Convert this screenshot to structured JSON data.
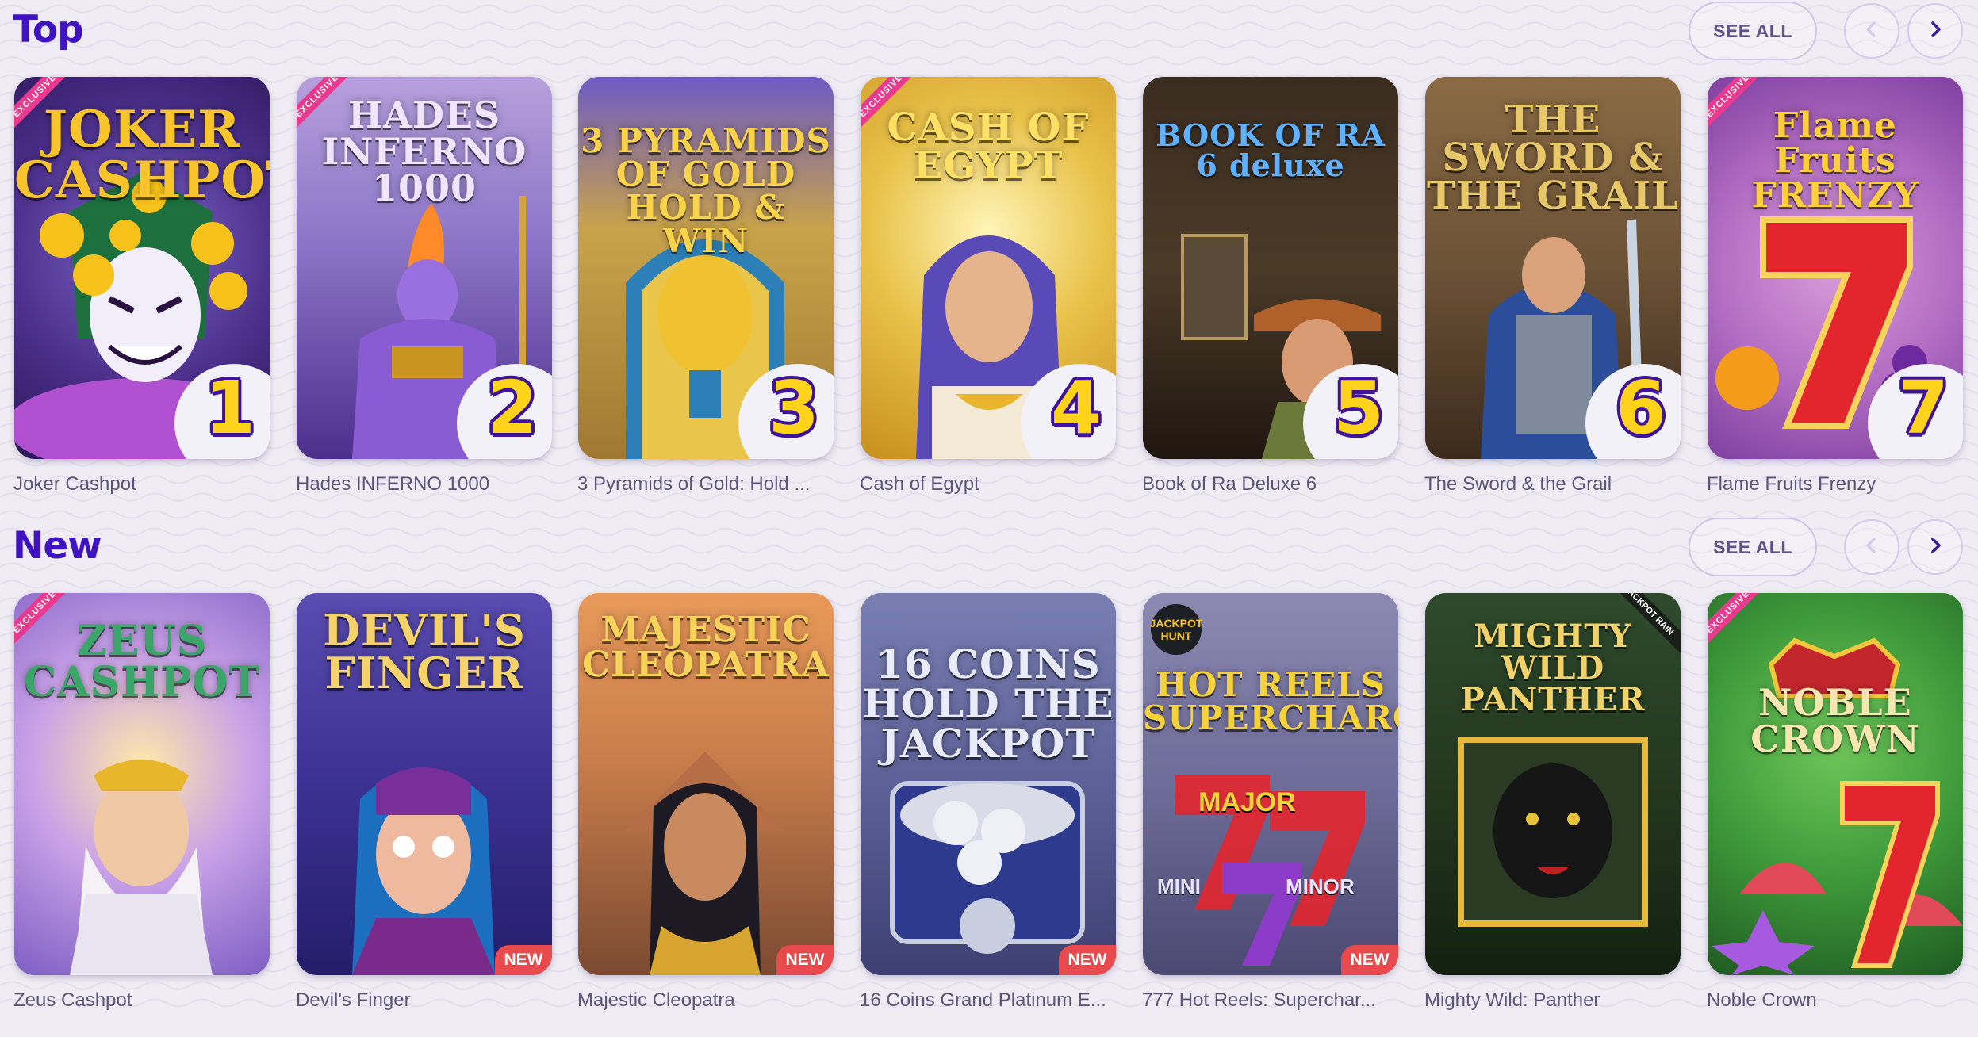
{
  "top": {
    "title": "Top",
    "see_all_label": "SEE ALL",
    "games": [
      {
        "title": "Joker Cashpot",
        "art_name": "JOKER CASHPOT",
        "rank": "1",
        "exclusive": "EXCLUSIVE"
      },
      {
        "title": "Hades INFERNO 1000",
        "art_name": "HADES INFERNO 1000",
        "rank": "2",
        "exclusive": "EXCLUSIVE"
      },
      {
        "title": "3 Pyramids of Gold: Hold ...",
        "art_name": "3 PYRAMIDS OF GOLD HOLD & WIN",
        "rank": "3"
      },
      {
        "title": "Cash of Egypt",
        "art_name": "CASH OF EGYPT",
        "rank": "4",
        "exclusive": "EXCLUSIVE"
      },
      {
        "title": "Book of Ra Deluxe 6",
        "art_name": "BOOK OF RA 6 deluxe",
        "rank": "5"
      },
      {
        "title": "The Sword & the Grail",
        "art_name": "THE SWORD & THE GRAIL",
        "rank": "6"
      },
      {
        "title": "Flame Fruits Frenzy",
        "art_name": "Flame Fruits FRENZY",
        "rank": "7",
        "exclusive": "EXCLUSIVE"
      }
    ]
  },
  "new": {
    "title": "New",
    "see_all_label": "SEE ALL",
    "badge_label": "NEW",
    "games": [
      {
        "title": "Zeus Cashpot",
        "art_name": "ZEUS CASHPOT",
        "exclusive": "EXCLUSIVE"
      },
      {
        "title": "Devil's Finger",
        "art_name": "DEVIL'S FINGER"
      },
      {
        "title": "Majestic Cleopatra",
        "art_name": "MAJESTIC CLEOPATRA"
      },
      {
        "title": "16 Coins Grand Platinum E...",
        "art_name": "16 COINS HOLD THE JACKPOT"
      },
      {
        "title": "777 Hot Reels: Superchar...",
        "art_name": "HOT REELS SUPERCHARGED",
        "extra": [
          "JACKPOT HUNT",
          "MAJOR",
          "MINI",
          "MINOR"
        ]
      },
      {
        "title": "Mighty Wild: Panther",
        "art_name": "MIGHTY WILD PANTHER",
        "corner": "JACKPOT RAIN"
      },
      {
        "title": "Noble Crown",
        "art_name": "NOBLE CROWN",
        "exclusive": "EXCLUSIVE"
      }
    ]
  },
  "icons": {
    "prev": "chevron-left-icon",
    "next": "chevron-right-icon"
  },
  "colors": {
    "section_title": "#3f12c2",
    "background": "#efecf3",
    "new_badge": "#e84a4d",
    "rank_fill": "#ffd21c",
    "rank_outline": "#3d1596"
  }
}
